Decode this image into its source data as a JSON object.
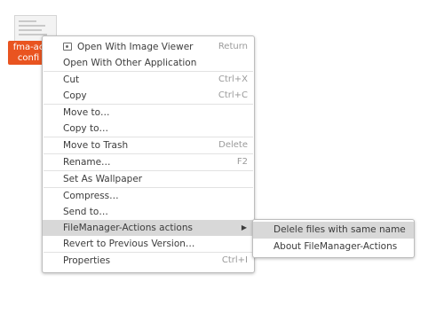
{
  "desktop_file": {
    "label_line1": "fma-ac",
    "label_line2": "confi"
  },
  "context_menu": {
    "items": [
      {
        "label": "Open With Image Viewer",
        "accel": "Return",
        "icon": "image-viewer-icon"
      },
      {
        "label": "Open With Other Application",
        "accel": ""
      },
      {
        "label": "Cut",
        "accel": "Ctrl+X"
      },
      {
        "label": "Copy",
        "accel": "Ctrl+C"
      },
      {
        "label": "Move to…",
        "accel": ""
      },
      {
        "label": "Copy to…",
        "accel": ""
      },
      {
        "label": "Move to Trash",
        "accel": "Delete"
      },
      {
        "label": "Rename…",
        "accel": "F2"
      },
      {
        "label": "Set As Wallpaper",
        "accel": ""
      },
      {
        "label": "Compress…",
        "accel": ""
      },
      {
        "label": "Send to…",
        "accel": ""
      },
      {
        "label": "FileManager-Actions actions",
        "accel": "",
        "submenu_arrow": "▶"
      },
      {
        "label": "Revert to Previous Version…",
        "accel": ""
      },
      {
        "label": "Properties",
        "accel": "Ctrl+I"
      }
    ]
  },
  "submenu": {
    "items": [
      {
        "label": "Delele files with same name"
      },
      {
        "label": "About FileManager-Actions"
      }
    ]
  },
  "colors": {
    "selection_orange": "#e95420",
    "highlight_gray": "#d8d8d8"
  }
}
